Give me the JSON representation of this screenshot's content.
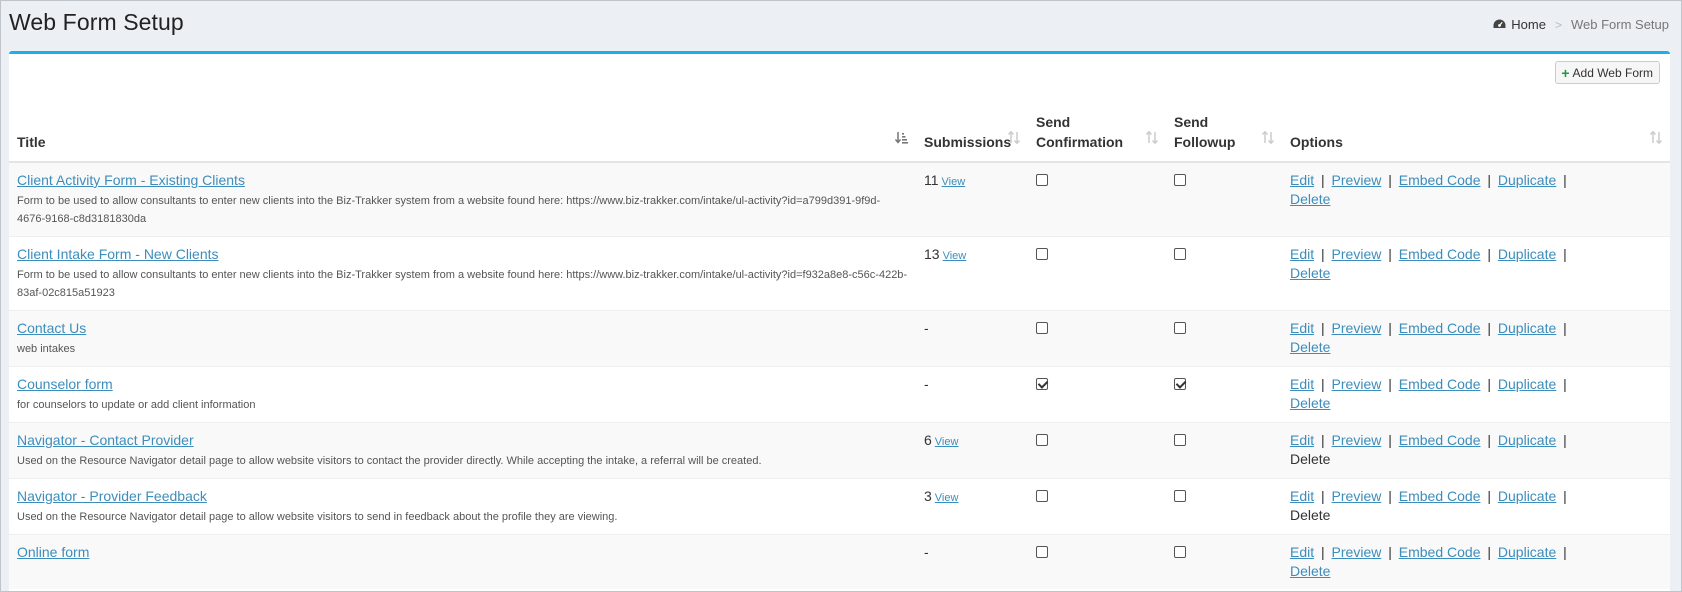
{
  "header": {
    "title": "Web Form Setup",
    "breadcrumb": {
      "home": "Home",
      "separator": ">",
      "current": "Web Form Setup"
    }
  },
  "toolbar": {
    "add_label": "Add Web Form"
  },
  "table": {
    "columns": {
      "title": "Title",
      "submissions": "Submissions",
      "send_confirmation": "Send Confirmation",
      "send_followup": "Send Followup",
      "options": "Options"
    },
    "option_labels": {
      "edit": "Edit",
      "preview": "Preview",
      "embed": "Embed Code",
      "duplicate": "Duplicate",
      "delete": "Delete",
      "sep": "|"
    },
    "view_label": "View",
    "rows": [
      {
        "title": "Client Activity Form - Existing Clients",
        "desc": "Form to be used to allow consultants to enter new clients into the Biz-Trakker system from a website found here: https://www.biz-trakker.com/intake/ul-activity?id=a799d391-9f9d-4676-9168-c8d3181830da",
        "count": "11",
        "has_view": true,
        "confirmation": false,
        "followup": false,
        "delete_link": true
      },
      {
        "title": "Client Intake Form - New Clients",
        "desc": "Form to be used to allow consultants to enter new clients into the Biz-Trakker system from a website found here: https://www.biz-trakker.com/intake/ul-activity?id=f932a8e8-c56c-422b-83af-02c815a51923",
        "count": "13",
        "has_view": true,
        "confirmation": false,
        "followup": false,
        "delete_link": true
      },
      {
        "title": "Contact Us",
        "desc": "web intakes",
        "count": "-",
        "has_view": false,
        "confirmation": false,
        "followup": false,
        "delete_link": true
      },
      {
        "title": "Counselor form",
        "desc": "for counselors to update or add client information",
        "count": "-",
        "has_view": false,
        "confirmation": true,
        "followup": true,
        "delete_link": true
      },
      {
        "title": "Navigator - Contact Provider",
        "desc": "Used on the Resource Navigator detail page to allow website visitors to contact the provider directly. While accepting the intake, a referral will be created.",
        "count": "6",
        "has_view": true,
        "confirmation": false,
        "followup": false,
        "delete_link": false
      },
      {
        "title": "Navigator - Provider Feedback",
        "desc": "Used on the Resource Navigator detail page to allow website visitors to send in feedback about the profile they are viewing.",
        "count": "3",
        "has_view": true,
        "confirmation": false,
        "followup": false,
        "delete_link": false
      },
      {
        "title": "Online form",
        "desc": "",
        "count": "-",
        "has_view": false,
        "confirmation": false,
        "followup": false,
        "delete_link": true
      }
    ]
  },
  "colors": {
    "accent": "#1ab0e8",
    "link": "#3c8dbc",
    "add_icon": "#1f9a3a"
  },
  "icons": {
    "home": "dashboard-icon",
    "add": "plus-icon",
    "sort": "sort-icon"
  }
}
